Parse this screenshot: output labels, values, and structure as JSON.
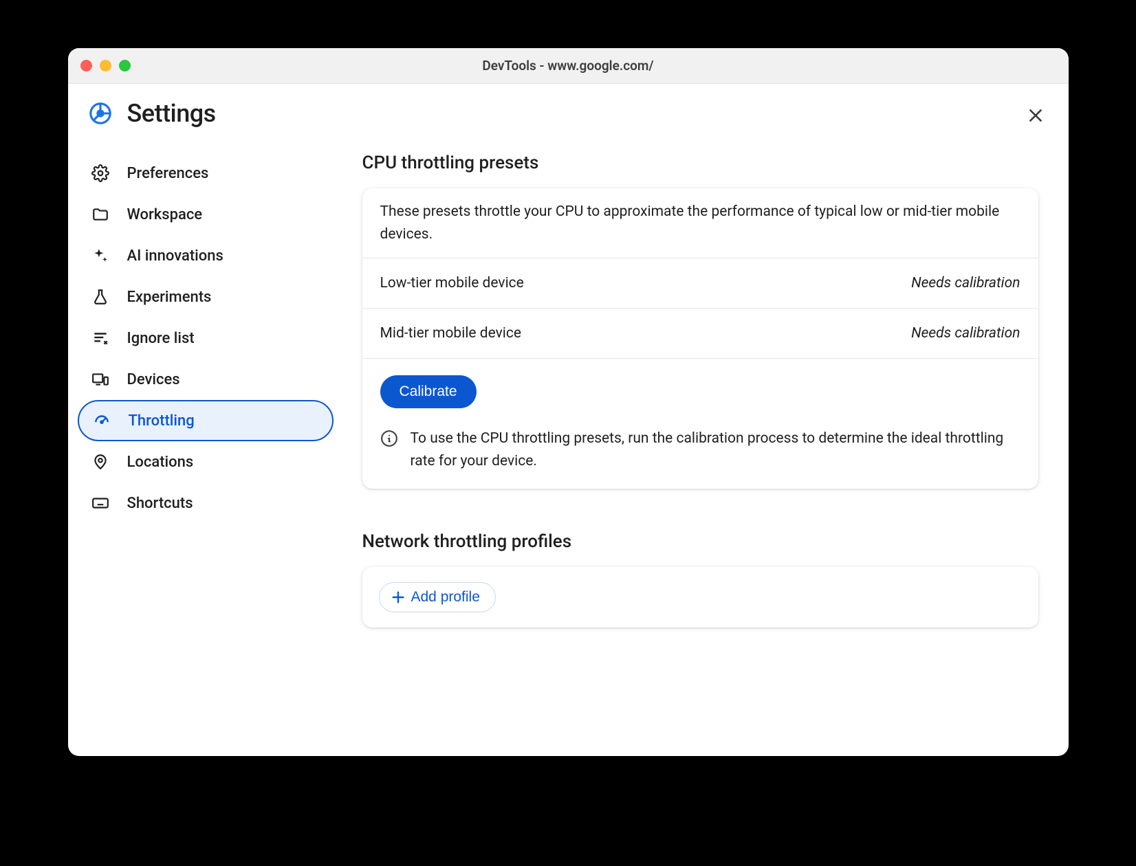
{
  "window": {
    "title": "DevTools - www.google.com/"
  },
  "page": {
    "title": "Settings"
  },
  "sidebar": {
    "items": [
      {
        "label": "Preferences"
      },
      {
        "label": "Workspace"
      },
      {
        "label": "AI innovations"
      },
      {
        "label": "Experiments"
      },
      {
        "label": "Ignore list"
      },
      {
        "label": "Devices"
      },
      {
        "label": "Throttling"
      },
      {
        "label": "Locations"
      },
      {
        "label": "Shortcuts"
      }
    ],
    "active_index": 6
  },
  "cpu_section": {
    "title": "CPU throttling presets",
    "description": "These presets throttle your CPU to approximate the performance of typical low or mid-tier mobile devices.",
    "presets": [
      {
        "name": "Low-tier mobile device",
        "status": "Needs calibration"
      },
      {
        "name": "Mid-tier mobile device",
        "status": "Needs calibration"
      }
    ],
    "calibrate_label": "Calibrate",
    "info_text": "To use the CPU throttling presets, run the calibration process to determine the ideal throttling rate for your device."
  },
  "network_section": {
    "title": "Network throttling profiles",
    "add_profile_label": "Add profile"
  }
}
